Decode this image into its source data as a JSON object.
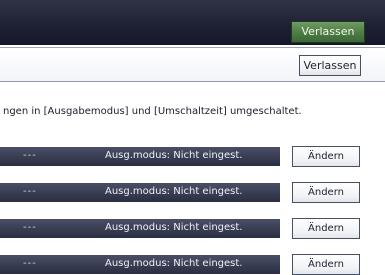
{
  "header": {
    "exit_label": "Verlassen"
  },
  "subheader": {
    "exit_label": "Verlassen"
  },
  "message": "ngen in [Ausgabemodus] und [Umschaltzeit] umgeschaltet.",
  "rows": [
    {
      "dash": "---",
      "status": "Ausg.modus: Nicht eingest.",
      "button_label": "Ändern"
    },
    {
      "dash": "---",
      "status": "Ausg.modus: Nicht eingest.",
      "button_label": "Ändern"
    },
    {
      "dash": "---",
      "status": "Ausg.modus: Nicht eingest.",
      "button_label": "Ändern"
    },
    {
      "dash": "---",
      "status": "Ausg.modus: Nicht eingest.",
      "button_label": "Ändern"
    }
  ]
}
